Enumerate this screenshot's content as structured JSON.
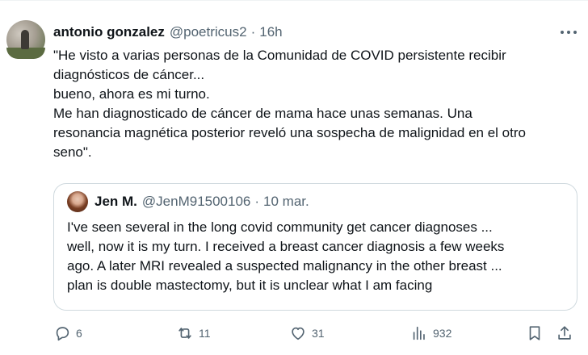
{
  "tweet": {
    "author_name": "antonio gonzalez",
    "author_handle": "@poetricus2",
    "separator": "·",
    "time": "16h",
    "text_lines": [
      "\"He visto a varias personas de la Comunidad de COVID persistente recibir",
      "diagnósticos de cáncer...",
      "bueno, ahora es mi turno.",
      "Me han diagnosticado de cáncer de mama hace unas semanas. Una",
      "resonancia magnética posterior reveló una sospecha de malignidad en el otro",
      "seno\"."
    ]
  },
  "quoted_tweet": {
    "author_name": "Jen M.",
    "author_handle": "@JenM91500106",
    "separator": "·",
    "date": "10 mar.",
    "text_lines": [
      "I've seen several in the long covid community get cancer diagnoses ...",
      "well, now it is my turn.  I received a breast cancer diagnosis a few weeks",
      "ago.  A later MRI revealed a suspected malignancy in the other breast ...",
      "plan is double mastectomy, but it is unclear what I am facing"
    ]
  },
  "actions": {
    "replies": {
      "icon": "reply-icon",
      "count": "6"
    },
    "retweets": {
      "icon": "retweet-icon",
      "count": "11"
    },
    "likes": {
      "icon": "heart-icon",
      "count": "31"
    },
    "views": {
      "icon": "views-icon",
      "count": "932"
    },
    "bookmark": {
      "icon": "bookmark-icon"
    },
    "share": {
      "icon": "share-icon"
    }
  },
  "colors": {
    "text_primary": "#0f1419",
    "text_secondary": "#536471",
    "border": "#cfd9de"
  }
}
